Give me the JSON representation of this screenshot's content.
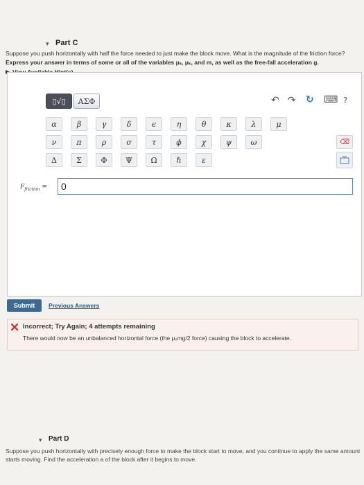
{
  "part_c": {
    "caret": "▾",
    "title": "Part C",
    "question_line1": "Suppose you push horizontally with half the force needed to just make the block move. What is the magnitude of the friction force?",
    "question_line2": "Express your answer in terms of some or all of the variables μₛ, μₖ, and m, as well as the free-fall acceleration g.",
    "hint_arrow": "▶",
    "hint_label": "View Available Hint(s)"
  },
  "toolbar": {
    "template_label": "▯√▯",
    "greek_label": "ΑΣΦ",
    "undo": "↶",
    "redo": "↷",
    "reset": "↻",
    "keyboard": "⌨",
    "help": "?"
  },
  "keypad": {
    "row1": [
      "α",
      "β",
      "γ",
      "δ",
      "ϵ",
      "η",
      "θ",
      "κ",
      "λ",
      "μ"
    ],
    "row2": [
      "ν",
      "π",
      "ρ",
      "σ",
      "τ",
      "ϕ",
      "χ",
      "ψ",
      "ω"
    ],
    "row3": [
      "Δ",
      "Σ",
      "Φ",
      "Ψ",
      "Ω",
      "ℏ",
      "ε"
    ],
    "delete": "⌫"
  },
  "answer": {
    "label": "F",
    "subscript": "friction",
    "equals": "=",
    "value": "0"
  },
  "actions": {
    "submit_label": "Submit",
    "previous_answers_label": "Previous Answers"
  },
  "feedback": {
    "title": "Incorrect; Try Again; 4 attempts remaining",
    "body": "There would now be an unbalanced horizontal force (the μₛmg/2 force) causing the block to accelerate.",
    "status_color": "#d9251c"
  },
  "part_d": {
    "caret": "▾",
    "title": "Part D",
    "text_line1": "Suppose you push horizontally with precisely enough force to make the block start to move, and you continue to apply the same amount of force even after it",
    "text_line2": "starts moving. Find the acceleration a of the block after it begins to move."
  }
}
